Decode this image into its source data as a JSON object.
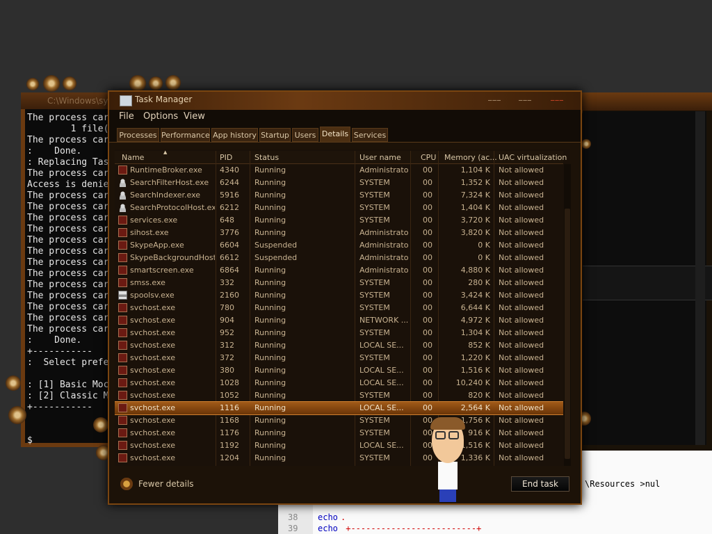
{
  "console": {
    "title": "C:\\Windows\\sys",
    "lines": [
      "The process car",
      "        1 file(",
      "The process car",
      ":    Done.",
      ": Replacing Tas",
      "The process car",
      "Access is denie",
      "The process car",
      "The process car",
      "The process car",
      "The process car",
      "The process car",
      "The process car",
      "The process car",
      "The process car",
      "The process car",
      "The process car",
      "The process car",
      "The process car",
      "The process car",
      ":    Done.",
      "+-----------",
      ":  Select prefe",
      "",
      ": [1] Basic Moc",
      ": [2] Classic M",
      "+-----------"
    ],
    "prompt": "$"
  },
  "editor": {
    "fragment_text": "\\Resources >nul",
    "lines": [
      {
        "num": "38",
        "keyword": "echo",
        "rest": "."
      },
      {
        "num": "39",
        "keyword": "echo",
        "rest": " +-------------------------+"
      }
    ]
  },
  "taskmanager": {
    "title": "Task Manager",
    "window_buttons": [
      "‒‒‒",
      "‒‒‒",
      "‒‒‒"
    ],
    "menu": [
      "File",
      "Options",
      "View"
    ],
    "tabs": [
      "Processes",
      "Performance",
      "App history",
      "Startup",
      "Users",
      "Details",
      "Services"
    ],
    "active_tab": "Details",
    "columns": [
      "Name",
      "PID",
      "Status",
      "User name",
      "CPU",
      "Memory (ac...",
      "UAC virtualization"
    ],
    "rows": [
      {
        "icon": "window",
        "name": "RuntimeBroker.exe",
        "pid": "4340",
        "status": "Running",
        "user": "Administrator",
        "cpu": "00",
        "mem": "1,104 K",
        "uac": "Not allowed"
      },
      {
        "icon": "user",
        "name": "SearchFilterHost.exe",
        "pid": "6244",
        "status": "Running",
        "user": "SYSTEM",
        "cpu": "00",
        "mem": "1,352 K",
        "uac": "Not allowed"
      },
      {
        "icon": "user",
        "name": "SearchIndexer.exe",
        "pid": "5916",
        "status": "Running",
        "user": "SYSTEM",
        "cpu": "00",
        "mem": "7,324 K",
        "uac": "Not allowed"
      },
      {
        "icon": "user",
        "name": "SearchProtocolHost.exe",
        "pid": "6212",
        "status": "Running",
        "user": "SYSTEM",
        "cpu": "00",
        "mem": "1,404 K",
        "uac": "Not allowed"
      },
      {
        "icon": "window",
        "name": "services.exe",
        "pid": "648",
        "status": "Running",
        "user": "SYSTEM",
        "cpu": "00",
        "mem": "3,720 K",
        "uac": "Not allowed"
      },
      {
        "icon": "window",
        "name": "sihost.exe",
        "pid": "3776",
        "status": "Running",
        "user": "Administrator",
        "cpu": "00",
        "mem": "3,820 K",
        "uac": "Not allowed"
      },
      {
        "icon": "window",
        "name": "SkypeApp.exe",
        "pid": "6604",
        "status": "Suspended",
        "user": "Administrator",
        "cpu": "00",
        "mem": "0 K",
        "uac": "Not allowed"
      },
      {
        "icon": "window",
        "name": "SkypeBackgroundHost...",
        "pid": "6612",
        "status": "Suspended",
        "user": "Administrator",
        "cpu": "00",
        "mem": "0 K",
        "uac": "Not allowed"
      },
      {
        "icon": "window",
        "name": "smartscreen.exe",
        "pid": "6864",
        "status": "Running",
        "user": "Administrator",
        "cpu": "00",
        "mem": "4,880 K",
        "uac": "Not allowed"
      },
      {
        "icon": "window",
        "name": "smss.exe",
        "pid": "332",
        "status": "Running",
        "user": "SYSTEM",
        "cpu": "00",
        "mem": "280 K",
        "uac": "Not allowed"
      },
      {
        "icon": "printer",
        "name": "spoolsv.exe",
        "pid": "2160",
        "status": "Running",
        "user": "SYSTEM",
        "cpu": "00",
        "mem": "3,424 K",
        "uac": "Not allowed"
      },
      {
        "icon": "window",
        "name": "svchost.exe",
        "pid": "780",
        "status": "Running",
        "user": "SYSTEM",
        "cpu": "00",
        "mem": "6,644 K",
        "uac": "Not allowed"
      },
      {
        "icon": "window",
        "name": "svchost.exe",
        "pid": "904",
        "status": "Running",
        "user": "NETWORK ...",
        "cpu": "00",
        "mem": "4,972 K",
        "uac": "Not allowed"
      },
      {
        "icon": "window",
        "name": "svchost.exe",
        "pid": "952",
        "status": "Running",
        "user": "SYSTEM",
        "cpu": "00",
        "mem": "1,304 K",
        "uac": "Not allowed"
      },
      {
        "icon": "window",
        "name": "svchost.exe",
        "pid": "312",
        "status": "Running",
        "user": "LOCAL SE...",
        "cpu": "00",
        "mem": "852 K",
        "uac": "Not allowed"
      },
      {
        "icon": "window",
        "name": "svchost.exe",
        "pid": "372",
        "status": "Running",
        "user": "SYSTEM",
        "cpu": "00",
        "mem": "1,220 K",
        "uac": "Not allowed"
      },
      {
        "icon": "window",
        "name": "svchost.exe",
        "pid": "380",
        "status": "Running",
        "user": "LOCAL SE...",
        "cpu": "00",
        "mem": "1,516 K",
        "uac": "Not allowed"
      },
      {
        "icon": "window",
        "name": "svchost.exe",
        "pid": "1028",
        "status": "Running",
        "user": "LOCAL SE...",
        "cpu": "00",
        "mem": "10,240 K",
        "uac": "Not allowed"
      },
      {
        "icon": "window",
        "name": "svchost.exe",
        "pid": "1052",
        "status": "Running",
        "user": "SYSTEM",
        "cpu": "00",
        "mem": "820 K",
        "uac": "Not allowed"
      },
      {
        "icon": "window",
        "name": "svchost.exe",
        "pid": "1116",
        "status": "Running",
        "user": "LOCAL SE...",
        "cpu": "00",
        "mem": "2,564 K",
        "uac": "Not allowed",
        "selected": true
      },
      {
        "icon": "window",
        "name": "svchost.exe",
        "pid": "1168",
        "status": "Running",
        "user": "SYSTEM",
        "cpu": "00",
        "mem": "1,756 K",
        "uac": "Not allowed"
      },
      {
        "icon": "window",
        "name": "svchost.exe",
        "pid": "1176",
        "status": "Running",
        "user": "SYSTEM",
        "cpu": "00",
        "mem": "916 K",
        "uac": "Not allowed"
      },
      {
        "icon": "window",
        "name": "svchost.exe",
        "pid": "1192",
        "status": "Running",
        "user": "LOCAL SE...",
        "cpu": "00",
        "mem": "1,516 K",
        "uac": "Not allowed"
      },
      {
        "icon": "window",
        "name": "svchost.exe",
        "pid": "1204",
        "status": "Running",
        "user": "SYSTEM",
        "cpu": "00",
        "mem": "1,336 K",
        "uac": "Not allowed"
      }
    ],
    "fewer_details_label": "Fewer details",
    "end_task_label": "End task",
    "accent_color": "#a05a18"
  }
}
